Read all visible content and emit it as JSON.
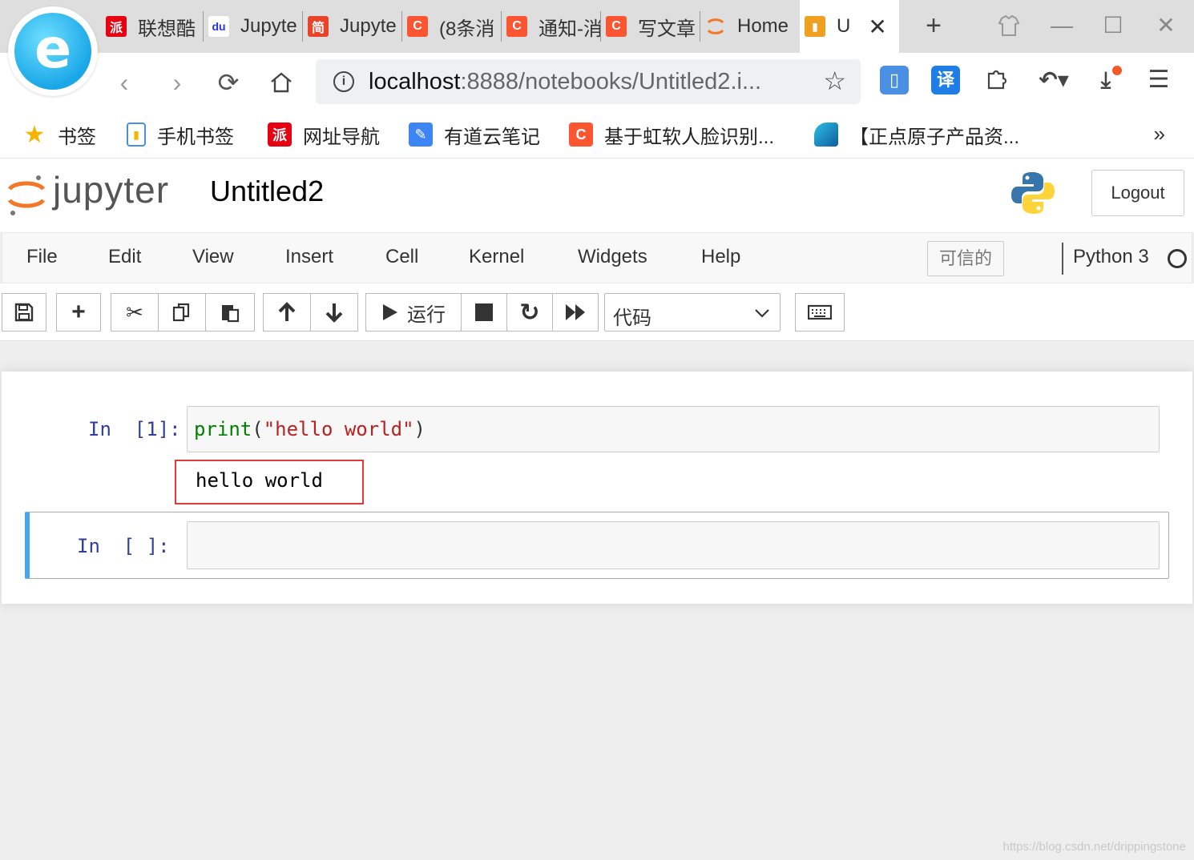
{
  "browser": {
    "tabs": [
      {
        "label": "联想酷",
        "fav_text": "派",
        "fav_color": "#e60012"
      },
      {
        "label": "Jupyte",
        "fav_text": "du",
        "fav_color": "#2932e1"
      },
      {
        "label": "Jupyte",
        "fav_text": "简",
        "fav_color": "#e8442a"
      },
      {
        "label": "(8条消",
        "fav_text": "C",
        "fav_color": "#fc5531"
      },
      {
        "label": "通知-消",
        "fav_text": "C",
        "fav_color": "#fc5531"
      },
      {
        "label": "写文章",
        "fav_text": "C",
        "fav_color": "#fc5531"
      },
      {
        "label": "Home",
        "fav_text": "",
        "fav_color": "#f37726"
      },
      {
        "label": "U",
        "fav_text": "",
        "fav_color": "#f0a020"
      }
    ],
    "new_tab": "+",
    "address": {
      "host": "localhost",
      "rest": ":8888/notebooks/Untitled2.i..."
    },
    "bookmarks": [
      {
        "label": "书签",
        "icon": "star-icon",
        "color": "#f5b400"
      },
      {
        "label": "手机书签",
        "icon": "phone-icon",
        "color": "#4a90e2"
      },
      {
        "label": "网址导航",
        "icon": "nav-icon",
        "color": "#e60012"
      },
      {
        "label": "有道云笔记",
        "icon": "note-icon",
        "color": "#3d85f5"
      },
      {
        "label": "基于虹软人脸识别...",
        "icon": "csdn-icon",
        "color": "#fc5531"
      },
      {
        "label": "【正点原子产品资...",
        "icon": "edge-icon",
        "color": "#0f7bc4"
      }
    ],
    "bookmarks_more": "»",
    "ext_translate": "译"
  },
  "jupyter": {
    "wordmark": "jupyter",
    "notebook_title": "Untitled2",
    "logout_label": "Logout",
    "menus": [
      "File",
      "Edit",
      "View",
      "Insert",
      "Cell",
      "Kernel",
      "Widgets",
      "Help"
    ],
    "trusted_label": "可信的",
    "kernel_name": "Python 3",
    "run_label": "运行",
    "cell_type": "代码",
    "accent_color": "#42a5f5",
    "prompt_color": "#303f9f"
  },
  "cells": [
    {
      "prompt": "In  [1]:",
      "code": {
        "fn": "print",
        "open": "(",
        "str": "\"hello world\"",
        "close": ")"
      },
      "output": "hello world"
    },
    {
      "prompt": "In  [ ]:",
      "code": ""
    }
  ],
  "watermark": "https://blog.csdn.net/drippingstone"
}
